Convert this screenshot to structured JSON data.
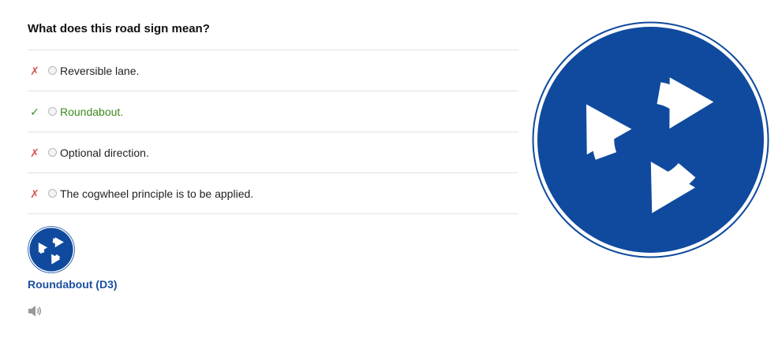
{
  "quiz": {
    "question": "What does this road sign mean?",
    "answers": [
      {
        "mark": "✗",
        "status": "wrong",
        "selected": false,
        "label": "Reversible lane."
      },
      {
        "mark": "✓",
        "status": "correct",
        "selected": false,
        "label": "Roundabout."
      },
      {
        "mark": "✗",
        "status": "wrong",
        "selected": false,
        "label": "Optional direction."
      },
      {
        "mark": "✗",
        "status": "wrong",
        "selected": false,
        "label": "The cogwheel principle is to be applied."
      }
    ]
  },
  "sign": {
    "caption": "Roundabout (D3)",
    "thumbnail_icon": "roundabout-sign-icon",
    "image_icon": "roundabout-sign-icon",
    "audio_icon": "speaker-icon"
  },
  "colors": {
    "sign_blue": "#0f4a9e",
    "caption_blue": "#1b4fa0",
    "correct_green": "#3c8a1e",
    "wrong_red": "#d9534f"
  }
}
